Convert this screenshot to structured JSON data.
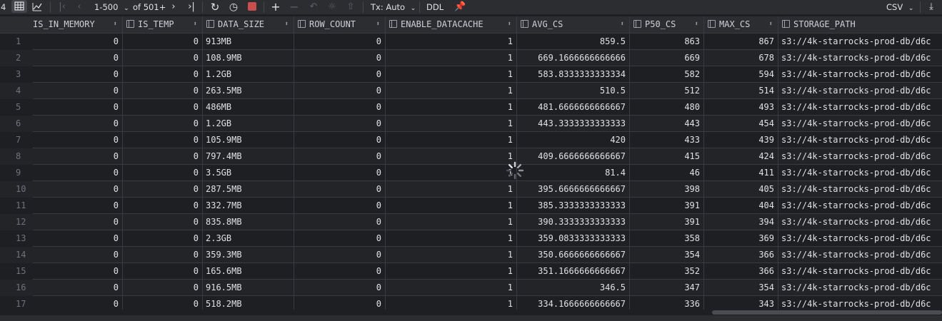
{
  "toolbar": {
    "left_digit": "4",
    "range": "1-500",
    "of_total": "of 501+",
    "tx_mode": "Tx: Auto",
    "ddl_label": "DDL",
    "export_format": "CSV"
  },
  "columns": [
    {
      "key": "is_in_memory",
      "label": "IS_IN_MEMORY"
    },
    {
      "key": "is_temp",
      "label": "IS_TEMP"
    },
    {
      "key": "data_size",
      "label": "DATA_SIZE"
    },
    {
      "key": "row_count",
      "label": "ROW_COUNT"
    },
    {
      "key": "enable_datacache",
      "label": "ENABLE_DATACACHE"
    },
    {
      "key": "avg_cs",
      "label": "AVG_CS"
    },
    {
      "key": "p50_cs",
      "label": "P50_CS"
    },
    {
      "key": "max_cs",
      "label": "MAX_CS"
    },
    {
      "key": "storage_path",
      "label": "STORAGE_PATH"
    }
  ],
  "rows": [
    {
      "n": "1",
      "is_in_memory": "0",
      "is_temp": "0",
      "data_size": "913MB",
      "row_count": "0",
      "enable_datacache": "1",
      "avg_cs": "859.5",
      "p50_cs": "863",
      "max_cs": "867",
      "storage_path": "s3://4k-starrocks-prod-db/d6c"
    },
    {
      "n": "2",
      "is_in_memory": "0",
      "is_temp": "0",
      "data_size": "108.9MB",
      "row_count": "0",
      "enable_datacache": "1",
      "avg_cs": "669.1666666666666",
      "p50_cs": "669",
      "max_cs": "678",
      "storage_path": "s3://4k-starrocks-prod-db/d6c"
    },
    {
      "n": "3",
      "is_in_memory": "0",
      "is_temp": "0",
      "data_size": "1.2GB",
      "row_count": "0",
      "enable_datacache": "1",
      "avg_cs": "583.8333333333334",
      "p50_cs": "582",
      "max_cs": "594",
      "storage_path": "s3://4k-starrocks-prod-db/d6c"
    },
    {
      "n": "4",
      "is_in_memory": "0",
      "is_temp": "0",
      "data_size": "263.5MB",
      "row_count": "0",
      "enable_datacache": "1",
      "avg_cs": "510.5",
      "p50_cs": "512",
      "max_cs": "514",
      "storage_path": "s3://4k-starrocks-prod-db/d6c"
    },
    {
      "n": "5",
      "is_in_memory": "0",
      "is_temp": "0",
      "data_size": "486MB",
      "row_count": "0",
      "enable_datacache": "1",
      "avg_cs": "481.6666666666667",
      "p50_cs": "480",
      "max_cs": "493",
      "storage_path": "s3://4k-starrocks-prod-db/d6c"
    },
    {
      "n": "6",
      "is_in_memory": "0",
      "is_temp": "0",
      "data_size": "1.2GB",
      "row_count": "0",
      "enable_datacache": "1",
      "avg_cs": "443.3333333333333",
      "p50_cs": "443",
      "max_cs": "454",
      "storage_path": "s3://4k-starrocks-prod-db/d6c"
    },
    {
      "n": "7",
      "is_in_memory": "0",
      "is_temp": "0",
      "data_size": "105.9MB",
      "row_count": "0",
      "enable_datacache": "1",
      "avg_cs": "420",
      "p50_cs": "433",
      "max_cs": "439",
      "storage_path": "s3://4k-starrocks-prod-db/d6c"
    },
    {
      "n": "8",
      "is_in_memory": "0",
      "is_temp": "0",
      "data_size": "797.4MB",
      "row_count": "0",
      "enable_datacache": "1",
      "avg_cs": "409.6666666666667",
      "p50_cs": "415",
      "max_cs": "424",
      "storage_path": "s3://4k-starrocks-prod-db/d6c"
    },
    {
      "n": "9",
      "is_in_memory": "0",
      "is_temp": "0",
      "data_size": "3.5GB",
      "row_count": "0",
      "enable_datacache": "1",
      "avg_cs": "81.4",
      "p50_cs": "46",
      "max_cs": "411",
      "storage_path": "s3://4k-starrocks-prod-db/d6c"
    },
    {
      "n": "10",
      "is_in_memory": "0",
      "is_temp": "0",
      "data_size": "287.5MB",
      "row_count": "0",
      "enable_datacache": "1",
      "avg_cs": "395.6666666666667",
      "p50_cs": "398",
      "max_cs": "405",
      "storage_path": "s3://4k-starrocks-prod-db/d6c"
    },
    {
      "n": "11",
      "is_in_memory": "0",
      "is_temp": "0",
      "data_size": "332.7MB",
      "row_count": "0",
      "enable_datacache": "1",
      "avg_cs": "385.3333333333333",
      "p50_cs": "391",
      "max_cs": "404",
      "storage_path": "s3://4k-starrocks-prod-db/d6c"
    },
    {
      "n": "12",
      "is_in_memory": "0",
      "is_temp": "0",
      "data_size": "835.8MB",
      "row_count": "0",
      "enable_datacache": "1",
      "avg_cs": "390.3333333333333",
      "p50_cs": "391",
      "max_cs": "394",
      "storage_path": "s3://4k-starrocks-prod-db/d6c"
    },
    {
      "n": "13",
      "is_in_memory": "0",
      "is_temp": "0",
      "data_size": "2.3GB",
      "row_count": "0",
      "enable_datacache": "1",
      "avg_cs": "359.0833333333333",
      "p50_cs": "358",
      "max_cs": "369",
      "storage_path": "s3://4k-starrocks-prod-db/d6c"
    },
    {
      "n": "14",
      "is_in_memory": "0",
      "is_temp": "0",
      "data_size": "359.3MB",
      "row_count": "0",
      "enable_datacache": "1",
      "avg_cs": "350.6666666666667",
      "p50_cs": "354",
      "max_cs": "366",
      "storage_path": "s3://4k-starrocks-prod-db/d6c"
    },
    {
      "n": "15",
      "is_in_memory": "0",
      "is_temp": "0",
      "data_size": "165.6MB",
      "row_count": "0",
      "enable_datacache": "1",
      "avg_cs": "351.1666666666667",
      "p50_cs": "352",
      "max_cs": "366",
      "storage_path": "s3://4k-starrocks-prod-db/d6c"
    },
    {
      "n": "16",
      "is_in_memory": "0",
      "is_temp": "0",
      "data_size": "916.5MB",
      "row_count": "0",
      "enable_datacache": "1",
      "avg_cs": "346.5",
      "p50_cs": "347",
      "max_cs": "354",
      "storage_path": "s3://4k-starrocks-prod-db/d6c"
    },
    {
      "n": "17",
      "is_in_memory": "0",
      "is_temp": "0",
      "data_size": "518.2MB",
      "row_count": "0",
      "enable_datacache": "1",
      "avg_cs": "334.1666666666667",
      "p50_cs": "336",
      "max_cs": "343",
      "storage_path": "s3://4k-starrocks-prod-db/d6c"
    }
  ]
}
